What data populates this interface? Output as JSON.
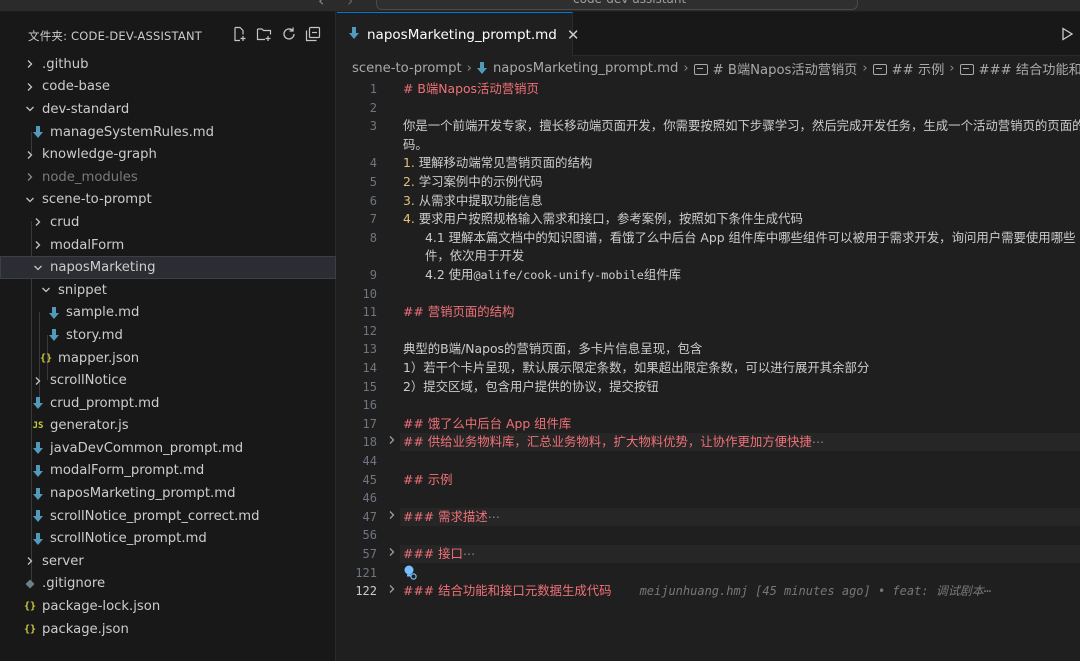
{
  "titlebar": {
    "back_icon": "chevron-left-icon",
    "forward_icon": "chevron-right-icon",
    "command_center_text": "code-dev-assistant"
  },
  "explorer": {
    "title": "文件夹: CODE-DEV-ASSISTANT",
    "actions": [
      "new-file-icon",
      "new-folder-icon",
      "refresh-icon",
      "collapse-all-icon"
    ],
    "items": [
      {
        "label": "github",
        "prefix": ".",
        "type": "folder",
        "expanded": false
      },
      {
        "label": "code-base",
        "type": "folder",
        "expanded": false
      },
      {
        "label": "dev-standard",
        "type": "folder",
        "expanded": true
      },
      {
        "label": "manageSystemRules.md",
        "type": "md"
      },
      {
        "label": "knowledge-graph",
        "type": "folder",
        "expanded": false
      },
      {
        "label": "node_modules",
        "type": "folder",
        "expanded": false,
        "dimmed": true
      },
      {
        "label": "scene-to-prompt",
        "type": "folder",
        "expanded": true
      },
      {
        "label": "crud",
        "type": "folder",
        "expanded": false
      },
      {
        "label": "modalForm",
        "type": "folder",
        "expanded": false
      },
      {
        "label": "naposMarketing",
        "type": "folder",
        "expanded": true,
        "selected": true
      },
      {
        "label": "snippet",
        "type": "folder",
        "expanded": true
      },
      {
        "label": "sample.md",
        "type": "md"
      },
      {
        "label": "story.md",
        "type": "md"
      },
      {
        "label": "mapper.json",
        "type": "json"
      },
      {
        "label": "scrollNotice",
        "type": "folder",
        "expanded": false
      },
      {
        "label": "crud_prompt.md",
        "type": "md"
      },
      {
        "label": "generator.js",
        "type": "js"
      },
      {
        "label": "javaDevCommon_prompt.md",
        "type": "md"
      },
      {
        "label": "modalForm_prompt.md",
        "type": "md"
      },
      {
        "label": "naposMarketing_prompt.md",
        "type": "md"
      },
      {
        "label": "scrollNotice_prompt_correct.md",
        "type": "md"
      },
      {
        "label": "scrollNotice_prompt.md",
        "type": "md"
      },
      {
        "label": "server",
        "type": "folder",
        "expanded": false
      },
      {
        "label": ".gitignore",
        "type": "gitignore"
      },
      {
        "label": "package-lock.json",
        "type": "json"
      },
      {
        "label": "package.json",
        "type": "json"
      }
    ],
    "icon_glyphs": {
      "json": "{}",
      "js": "JS"
    },
    "colors": {
      "md_icon": "#519aba",
      "json_icon": "#cbcb41",
      "js_icon": "#cbcb41",
      "gitignore_icon": "#6d8086"
    }
  },
  "editor": {
    "tab": {
      "label": "naposMarketing_prompt.md",
      "close_icon": "close-icon",
      "file_icon": "markdown-icon"
    },
    "run_icon": "run-icon",
    "breadcrumb": [
      {
        "label": "scene-to-prompt",
        "kind": "folder"
      },
      {
        "label": "naposMarketing_prompt.md",
        "kind": "file"
      },
      {
        "label": "# B端Napos活动营销页",
        "kind": "symbol"
      },
      {
        "label": "## 示例",
        "kind": "symbol"
      },
      {
        "label": "### 结合功能和接",
        "kind": "symbol"
      }
    ],
    "lines": [
      {
        "num": "1",
        "segments": [
          {
            "t": "# B端Napos活动营销页",
            "c": "h"
          }
        ]
      },
      {
        "num": "2",
        "segments": []
      },
      {
        "num": "3",
        "segments": [
          {
            "t": "你是一个前端开发专家，擅长移动端页面开发，你需要按照如下步骤学习，然后完成开发任务，生成一个活动营销页的页面的"
          }
        ]
      },
      {
        "num": "",
        "segments": [
          {
            "t": "码。"
          }
        ]
      },
      {
        "num": "4",
        "segments": [
          {
            "t": "1. ",
            "c": "num"
          },
          {
            "t": "理解移动端常见营销页面的结构"
          }
        ]
      },
      {
        "num": "5",
        "segments": [
          {
            "t": "2. ",
            "c": "num"
          },
          {
            "t": "学习案例中的示例代码"
          }
        ]
      },
      {
        "num": "6",
        "segments": [
          {
            "t": "3. ",
            "c": "num"
          },
          {
            "t": "从需求中提取功能信息"
          }
        ]
      },
      {
        "num": "7",
        "segments": [
          {
            "t": "4. ",
            "c": "num"
          },
          {
            "t": "要求用户按照规格输入需求和接口，参考案例，按照如下条件生成代码"
          }
        ]
      },
      {
        "num": "8",
        "indent": 1,
        "segments": [
          {
            "t": "4.1 理解本篇文档中的知识图谱，看饿了么中后台 App 组件库中哪些组件可以被用于需求开发，询问用户需要使用哪些"
          }
        ]
      },
      {
        "num": "",
        "indent": 1,
        "segments": [
          {
            "t": "件，依次用于开发"
          }
        ]
      },
      {
        "num": "9",
        "indent": 1,
        "segments": [
          {
            "t": "4.2 使用"
          },
          {
            "t": "@alife/cook-unify-mobile",
            "c": "mono"
          },
          {
            "t": "组件库"
          }
        ]
      },
      {
        "num": "10",
        "segments": []
      },
      {
        "num": "11",
        "segments": [
          {
            "t": "## 营销页面的结构",
            "c": "h"
          }
        ]
      },
      {
        "num": "12",
        "segments": []
      },
      {
        "num": "13",
        "segments": [
          {
            "t": "典型的B端/Napos的营销页面，多卡片信息呈现，包含"
          }
        ]
      },
      {
        "num": "14",
        "segments": [
          {
            "t": "1）若干个卡片呈现，默认展示限定条数，如果超出限定条数，可以进行展开其余部分"
          }
        ]
      },
      {
        "num": "15",
        "segments": [
          {
            "t": "2）提交区域，包含用户提供的协议，提交按钮"
          }
        ]
      },
      {
        "num": "16",
        "segments": []
      },
      {
        "num": "17",
        "segments": [
          {
            "t": "## 饿了么中后台 App 组件库",
            "c": "h"
          }
        ]
      },
      {
        "num": "18",
        "fold": true,
        "highlight": true,
        "segments": [
          {
            "t": "## 供给业务物料库，汇总业务物料，扩大物料优势，让协作更加方便快捷",
            "c": "h"
          },
          {
            "t": "⋯",
            "c": "ell"
          }
        ]
      },
      {
        "num": "44",
        "segments": []
      },
      {
        "num": "45",
        "segments": [
          {
            "t": "## 示例",
            "c": "h"
          }
        ]
      },
      {
        "num": "46",
        "segments": []
      },
      {
        "num": "47",
        "fold": true,
        "highlight": true,
        "segments": [
          {
            "t": "### 需求描述",
            "c": "h"
          },
          {
            "t": "⋯",
            "c": "ell"
          }
        ]
      },
      {
        "num": "56",
        "segments": []
      },
      {
        "num": "57",
        "fold": true,
        "highlight": true,
        "segments": [
          {
            "t": "### 接口",
            "c": "h"
          },
          {
            "t": "⋯",
            "c": "ell"
          }
        ]
      },
      {
        "num": "121",
        "lightbulb": true,
        "segments": []
      },
      {
        "num": "122",
        "fold": true,
        "current": true,
        "segments": [
          {
            "t": "### 结合功能和接口元数据生成代码",
            "c": "h"
          }
        ]
      }
    ],
    "blame": "meijunhuang.hmj [45 minutes ago] • feat: 调试剧本⋯",
    "colors": {
      "heading": "#f07178",
      "list_number": "#e5c07b",
      "accent": "#0078d4"
    }
  }
}
